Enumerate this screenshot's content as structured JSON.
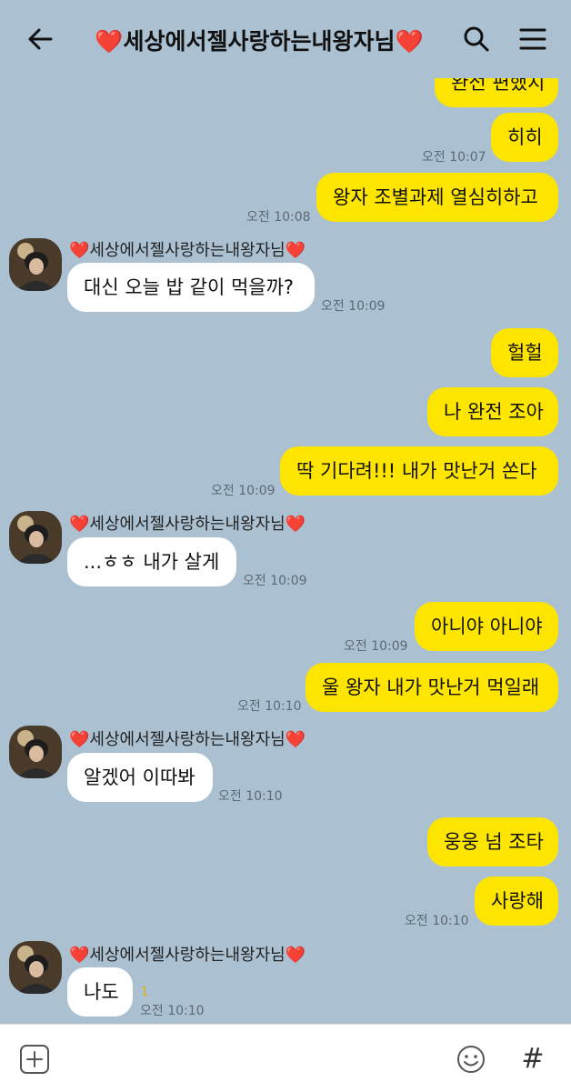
{
  "header": {
    "heart_left": "❤️",
    "title": "세상에서젤사랑하는내왕자님",
    "heart_right": "❤️"
  },
  "contact": {
    "name": "세상에서젤사랑하는내왕자님",
    "heart": "❤️"
  },
  "messages": {
    "m0": {
      "text": "완전 편했지"
    },
    "m1": {
      "text": "히히",
      "time": "오전 10:07"
    },
    "m2": {
      "text": "왕자 조별과제 열심히하고",
      "time": "오전 10:08"
    },
    "m3": {
      "text": "대신 오늘 밥 같이 먹을까?",
      "time": "오전 10:09"
    },
    "m4": {
      "text": "헐헐"
    },
    "m5": {
      "text": "나 완전 조아"
    },
    "m6": {
      "text": "딱 기다려!!! 내가 맛난거 쏜다",
      "time": "오전 10:09"
    },
    "m7": {
      "text": "...ㅎㅎ 내가 살게",
      "time": "오전 10:09"
    },
    "m8": {
      "text": "아니야 아니야",
      "time": "오전 10:09"
    },
    "m9": {
      "text": "울 왕자 내가 맛난거 먹일래",
      "time": "오전 10:10"
    },
    "m10": {
      "text": "알겠어 이따봐",
      "time": "오전 10:10"
    },
    "m11": {
      "text": "웅웅 넘 조타"
    },
    "m12": {
      "text": "사랑해",
      "time": "오전 10:10"
    },
    "m13": {
      "text": "나도",
      "time": "오전 10:10",
      "unread": "1"
    }
  },
  "icons": {
    "back": "back-arrow-icon",
    "search": "search-icon",
    "menu": "menu-icon",
    "attach": "plus-box-icon",
    "emoji": "emoji-icon",
    "hashtag": "hash-icon"
  },
  "input": {
    "hashtag": "#"
  },
  "colors": {
    "background": "#abc1d1",
    "outgoing_bubble": "#fee500",
    "incoming_bubble": "#ffffff",
    "heart": "#e3183b"
  }
}
